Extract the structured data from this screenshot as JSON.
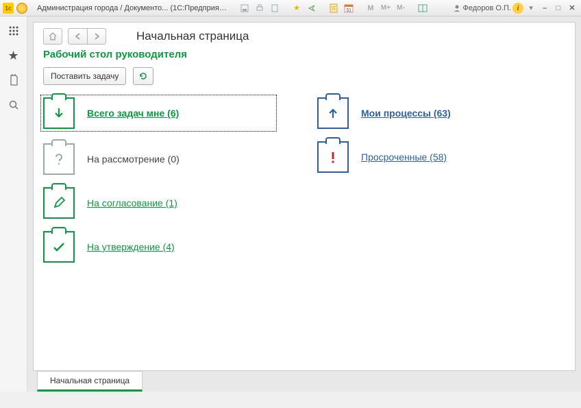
{
  "titlebar": {
    "title": "Администрация города / Документо... (1С:Предприятие)",
    "user": "Федоров О.П."
  },
  "page": {
    "title": "Начальная страница",
    "section_title": "Рабочий стол руководителя",
    "post_task_label": "Поставить задачу"
  },
  "left_col": [
    {
      "label": "Всего задач мне (6)",
      "style": "link bold",
      "icon": "arrow-down",
      "color": "green",
      "selected": true
    },
    {
      "label": "На рассмотрение (0)",
      "style": "plain",
      "icon": "question",
      "color": "gray"
    },
    {
      "label": "На согласование (1)",
      "style": "link",
      "icon": "pencil",
      "color": "green"
    },
    {
      "label": "На утверждение (4)",
      "style": "link",
      "icon": "check",
      "color": "green"
    }
  ],
  "right_col": [
    {
      "label": "Мои процессы (63)",
      "style": "link bold blue",
      "icon": "arrow-up",
      "color": "blue"
    },
    {
      "label": "Просроченные (58)",
      "style": "link blue",
      "icon": "exclaim",
      "color": "redborder"
    }
  ],
  "bottom_tab": "Начальная страница"
}
